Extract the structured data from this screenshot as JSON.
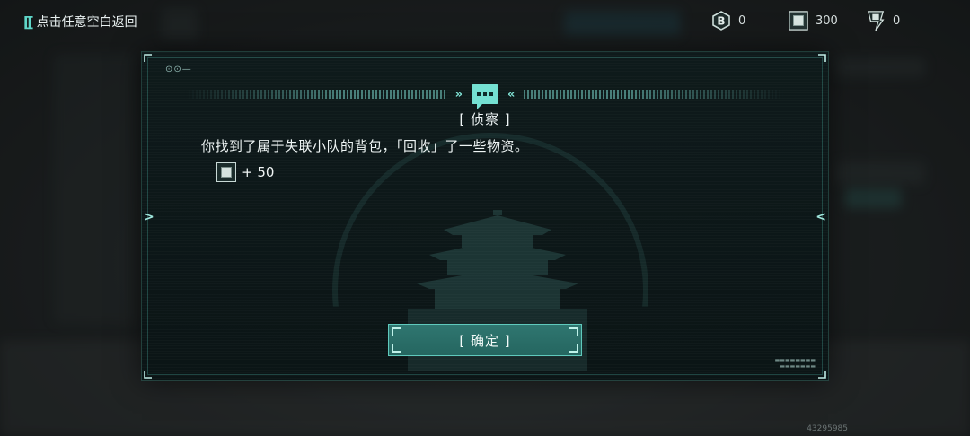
{
  "header": {
    "back_label": "点击任意空白返回",
    "resources": [
      {
        "icon": "currency-b-icon",
        "value": "0"
      },
      {
        "icon": "supply-crate-icon",
        "value": "300"
      },
      {
        "icon": "ticket-icon",
        "value": "0"
      }
    ]
  },
  "dialog": {
    "title": "[ 侦察 ]",
    "message": "你找到了属于失联小队的背包，「回收」了一些物资。",
    "reward": {
      "icon": "supply-crate-icon",
      "amount": "+ 50"
    },
    "confirm_label": "[ 确定 ]"
  },
  "footer": {
    "uid": "43295985"
  },
  "colors": {
    "accent": "#74e0d2",
    "button": "#2f7670",
    "panel": "#0e1a1b"
  }
}
